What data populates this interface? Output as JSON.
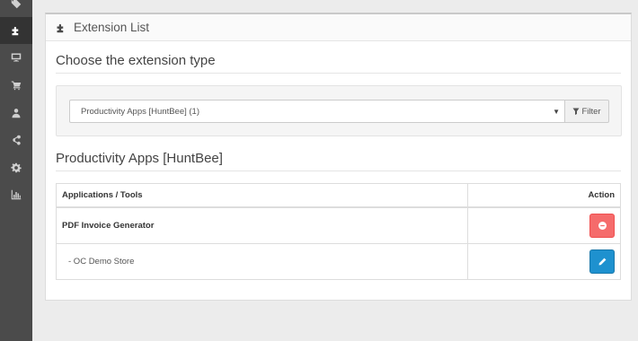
{
  "sidebar": {
    "items": [
      {
        "icon": "tag-icon"
      },
      {
        "icon": "puzzle-icon",
        "active": true
      },
      {
        "icon": "desktop-icon"
      },
      {
        "icon": "cart-icon"
      },
      {
        "icon": "user-icon"
      },
      {
        "icon": "share-icon"
      },
      {
        "icon": "gear-icon"
      },
      {
        "icon": "bar-chart-icon"
      }
    ]
  },
  "panel": {
    "title": "Extension List",
    "choose_label": "Choose the extension type",
    "select_value": "Productivity Apps [HuntBee] (1)",
    "filter_label": "Filter",
    "section_title": "Productivity Apps [HuntBee]"
  },
  "table": {
    "headers": {
      "app": "Applications / Tools",
      "action": "Action"
    },
    "rows": [
      {
        "name": "PDF Invoice Generator",
        "action": "uninstall"
      },
      {
        "name": "-   OC Demo Store",
        "action": "edit"
      }
    ]
  },
  "colors": {
    "sidebar": "#4b4b4b",
    "danger": "#f56b6b",
    "primary": "#1e91cf"
  }
}
